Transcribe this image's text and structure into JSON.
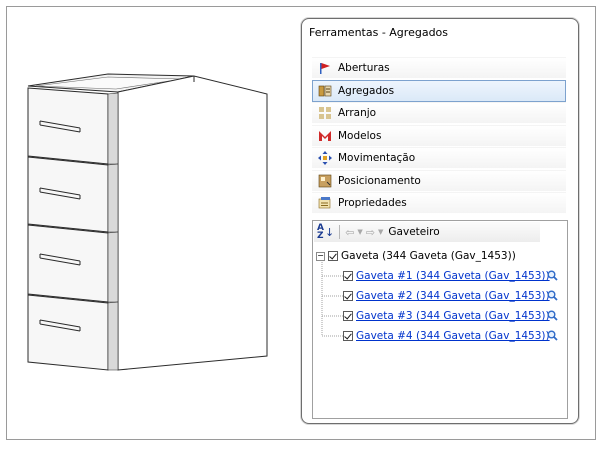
{
  "panel": {
    "title": "Ferramentas - Agregados"
  },
  "menu": [
    {
      "label": "Aberturas",
      "icon": "flag-icon",
      "selected": false
    },
    {
      "label": "Agregados",
      "icon": "drawer-aggregate-icon",
      "selected": true
    },
    {
      "label": "Arranjo",
      "icon": "grid-icon",
      "selected": false
    },
    {
      "label": "Modelos",
      "icon": "models-icon",
      "selected": false
    },
    {
      "label": "Movimentação",
      "icon": "move-icon",
      "selected": false
    },
    {
      "label": "Posicionamento",
      "icon": "position-icon",
      "selected": false
    },
    {
      "label": "Propriedades",
      "icon": "properties-icon",
      "selected": false
    }
  ],
  "toolbar": {
    "breadcrumb": "Gaveteiro"
  },
  "tree": {
    "root": {
      "label": "Gaveta (344 Gaveta (Gav_1453))",
      "checked": true
    },
    "children": [
      {
        "label": "Gaveta #1 (344 Gaveta (Gav_1453))",
        "checked": true
      },
      {
        "label": "Gaveta #2 (344 Gaveta (Gav_1453))",
        "checked": true
      },
      {
        "label": "Gaveta #3 (344 Gaveta (Gav_1453))",
        "checked": true
      },
      {
        "label": "Gaveta #4 (344 Gaveta (Gav_1453))",
        "checked": true
      }
    ]
  },
  "colors": {
    "link": "#0033cc",
    "selection_border": "#7da2ce",
    "selection_fill": "#dbe9f8"
  }
}
